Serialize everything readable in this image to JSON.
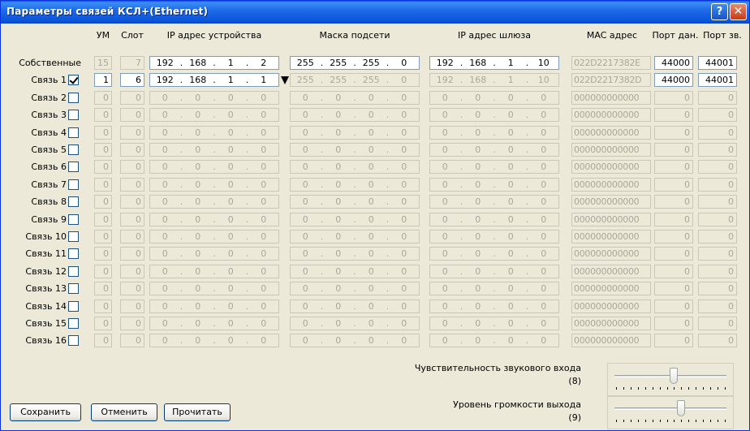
{
  "window": {
    "title": "Параметры связей КСЛ+(Ethernet)",
    "help_glyph": "?",
    "close_glyph": "✕"
  },
  "headers": {
    "um": "УМ",
    "slot": "Слот",
    "ip_device": "IP адрес устройства",
    "mask": "Маска подсети",
    "gateway": "IP адрес шлюза",
    "mac": "MAC адрес",
    "port_data": "Порт дан.",
    "port_sound": "Порт зв."
  },
  "rows": [
    {
      "label": "Собственные",
      "checkbox": null,
      "enabled": true,
      "um": "15",
      "slot": "7",
      "um_enabled": false,
      "ip": [
        "192",
        "168",
        "1",
        "2"
      ],
      "mask": [
        "255",
        "255",
        "255",
        "0"
      ],
      "mask_enabled": true,
      "gw": [
        "192",
        "168",
        "1",
        "10"
      ],
      "gw_enabled": true,
      "mac": "022D2217382E",
      "port_data": "44000",
      "port_sound": "44001"
    },
    {
      "label": "Связь 1",
      "checkbox": true,
      "enabled": true,
      "um": "1",
      "slot": "6",
      "um_enabled": true,
      "ip": [
        "192",
        "168",
        "1",
        "1"
      ],
      "mask": [
        "255",
        "255",
        "255",
        "0"
      ],
      "mask_enabled": false,
      "gw": [
        "192",
        "168",
        "1",
        "10"
      ],
      "gw_enabled": false,
      "mac": "022D2217382D",
      "port_data": "44000",
      "port_sound": "44001"
    },
    {
      "label": "Связь 2",
      "checkbox": false,
      "enabled": false,
      "um": "0",
      "slot": "0",
      "ip": [
        "0",
        "0",
        "0",
        "0"
      ],
      "mask": [
        "0",
        "0",
        "0",
        "0"
      ],
      "gw": [
        "0",
        "0",
        "0",
        "0"
      ],
      "mac": "000000000000",
      "port_data": "0",
      "port_sound": "0"
    },
    {
      "label": "Связь 3",
      "checkbox": false,
      "enabled": false,
      "um": "0",
      "slot": "0",
      "ip": [
        "0",
        "0",
        "0",
        "0"
      ],
      "mask": [
        "0",
        "0",
        "0",
        "0"
      ],
      "gw": [
        "0",
        "0",
        "0",
        "0"
      ],
      "mac": "000000000000",
      "port_data": "0",
      "port_sound": "0"
    },
    {
      "label": "Связь 4",
      "checkbox": false,
      "enabled": false,
      "um": "0",
      "slot": "0",
      "ip": [
        "0",
        "0",
        "0",
        "0"
      ],
      "mask": [
        "0",
        "0",
        "0",
        "0"
      ],
      "gw": [
        "0",
        "0",
        "0",
        "0"
      ],
      "mac": "000000000000",
      "port_data": "0",
      "port_sound": "0"
    },
    {
      "label": "Связь 5",
      "checkbox": false,
      "enabled": false,
      "um": "0",
      "slot": "0",
      "ip": [
        "0",
        "0",
        "0",
        "0"
      ],
      "mask": [
        "0",
        "0",
        "0",
        "0"
      ],
      "gw": [
        "0",
        "0",
        "0",
        "0"
      ],
      "mac": "000000000000",
      "port_data": "0",
      "port_sound": "0"
    },
    {
      "label": "Связь 6",
      "checkbox": false,
      "enabled": false,
      "um": "0",
      "slot": "0",
      "ip": [
        "0",
        "0",
        "0",
        "0"
      ],
      "mask": [
        "0",
        "0",
        "0",
        "0"
      ],
      "gw": [
        "0",
        "0",
        "0",
        "0"
      ],
      "mac": "000000000000",
      "port_data": "0",
      "port_sound": "0"
    },
    {
      "label": "Связь 7",
      "checkbox": false,
      "enabled": false,
      "um": "0",
      "slot": "0",
      "ip": [
        "0",
        "0",
        "0",
        "0"
      ],
      "mask": [
        "0",
        "0",
        "0",
        "0"
      ],
      "gw": [
        "0",
        "0",
        "0",
        "0"
      ],
      "mac": "000000000000",
      "port_data": "0",
      "port_sound": "0"
    },
    {
      "label": "Связь 8",
      "checkbox": false,
      "enabled": false,
      "um": "0",
      "slot": "0",
      "ip": [
        "0",
        "0",
        "0",
        "0"
      ],
      "mask": [
        "0",
        "0",
        "0",
        "0"
      ],
      "gw": [
        "0",
        "0",
        "0",
        "0"
      ],
      "mac": "000000000000",
      "port_data": "0",
      "port_sound": "0"
    },
    {
      "label": "Связь 9",
      "checkbox": false,
      "enabled": false,
      "um": "0",
      "slot": "0",
      "ip": [
        "0",
        "0",
        "0",
        "0"
      ],
      "mask": [
        "0",
        "0",
        "0",
        "0"
      ],
      "gw": [
        "0",
        "0",
        "0",
        "0"
      ],
      "mac": "000000000000",
      "port_data": "0",
      "port_sound": "0"
    },
    {
      "label": "Связь 10",
      "checkbox": false,
      "enabled": false,
      "um": "0",
      "slot": "0",
      "ip": [
        "0",
        "0",
        "0",
        "0"
      ],
      "mask": [
        "0",
        "0",
        "0",
        "0"
      ],
      "gw": [
        "0",
        "0",
        "0",
        "0"
      ],
      "mac": "000000000000",
      "port_data": "0",
      "port_sound": "0"
    },
    {
      "label": "Связь 11",
      "checkbox": false,
      "enabled": false,
      "um": "0",
      "slot": "0",
      "ip": [
        "0",
        "0",
        "0",
        "0"
      ],
      "mask": [
        "0",
        "0",
        "0",
        "0"
      ],
      "gw": [
        "0",
        "0",
        "0",
        "0"
      ],
      "mac": "000000000000",
      "port_data": "0",
      "port_sound": "0"
    },
    {
      "label": "Связь 12",
      "checkbox": false,
      "enabled": false,
      "um": "0",
      "slot": "0",
      "ip": [
        "0",
        "0",
        "0",
        "0"
      ],
      "mask": [
        "0",
        "0",
        "0",
        "0"
      ],
      "gw": [
        "0",
        "0",
        "0",
        "0"
      ],
      "mac": "000000000000",
      "port_data": "0",
      "port_sound": "0"
    },
    {
      "label": "Связь 13",
      "checkbox": false,
      "enabled": false,
      "um": "0",
      "slot": "0",
      "ip": [
        "0",
        "0",
        "0",
        "0"
      ],
      "mask": [
        "0",
        "0",
        "0",
        "0"
      ],
      "gw": [
        "0",
        "0",
        "0",
        "0"
      ],
      "mac": "000000000000",
      "port_data": "0",
      "port_sound": "0"
    },
    {
      "label": "Связь 14",
      "checkbox": false,
      "enabled": false,
      "um": "0",
      "slot": "0",
      "ip": [
        "0",
        "0",
        "0",
        "0"
      ],
      "mask": [
        "0",
        "0",
        "0",
        "0"
      ],
      "gw": [
        "0",
        "0",
        "0",
        "0"
      ],
      "mac": "000000000000",
      "port_data": "0",
      "port_sound": "0"
    },
    {
      "label": "Связь 15",
      "checkbox": false,
      "enabled": false,
      "um": "0",
      "slot": "0",
      "ip": [
        "0",
        "0",
        "0",
        "0"
      ],
      "mask": [
        "0",
        "0",
        "0",
        "0"
      ],
      "gw": [
        "0",
        "0",
        "0",
        "0"
      ],
      "mac": "000000000000",
      "port_data": "0",
      "port_sound": "0"
    },
    {
      "label": "Связь 16",
      "checkbox": false,
      "enabled": false,
      "um": "0",
      "slot": "0",
      "ip": [
        "0",
        "0",
        "0",
        "0"
      ],
      "mask": [
        "0",
        "0",
        "0",
        "0"
      ],
      "gw": [
        "0",
        "0",
        "0",
        "0"
      ],
      "mac": "000000000000",
      "port_data": "0",
      "port_sound": "0"
    }
  ],
  "sliders": {
    "sensitivity": {
      "label": "Чувствительность звукового входа",
      "value_text": "(8)",
      "value": 8,
      "max": 15
    },
    "volume": {
      "label": "Уровень громкости выхода",
      "value_text": "(9)",
      "value": 9,
      "max": 15
    }
  },
  "buttons": {
    "save": "Сохранить",
    "cancel": "Отменить",
    "read": "Прочитать"
  }
}
